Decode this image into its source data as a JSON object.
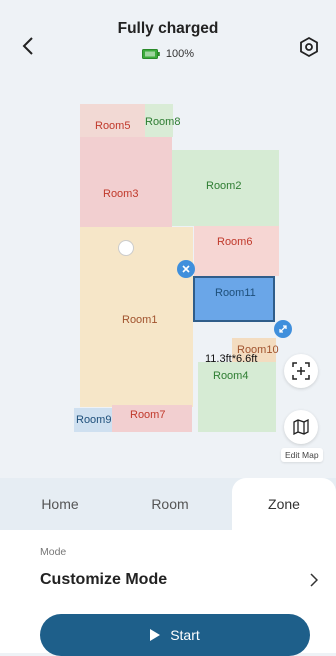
{
  "header": {
    "title": "Fully charged",
    "battery_level": "100%",
    "back_icon": "chevron-left-icon",
    "settings_icon": "settings-icon"
  },
  "map": {
    "rooms": [
      {
        "name": "Room5",
        "color": "#c0392b"
      },
      {
        "name": "Room8",
        "color": "#2e7d32"
      },
      {
        "name": "Room3",
        "color": "#c0392b"
      },
      {
        "name": "Room2",
        "color": "#2e7d32"
      },
      {
        "name": "Room6",
        "color": "#c0392b"
      },
      {
        "name": "Room11",
        "color": "#1e4f7a"
      },
      {
        "name": "Room1",
        "color": "#a0522d"
      },
      {
        "name": "Room10",
        "color": "#a0522d"
      },
      {
        "name": "Room4",
        "color": "#2e7d32"
      },
      {
        "name": "Room9",
        "color": "#1e4f7a"
      },
      {
        "name": "Room7",
        "color": "#c0392b"
      }
    ],
    "zone_size": "11.3ft*6.6ft",
    "edit_map_label": "Edit Map"
  },
  "tabs": [
    {
      "label": "Home",
      "active": false
    },
    {
      "label": "Room",
      "active": false
    },
    {
      "label": "Zone",
      "active": true
    }
  ],
  "mode": {
    "label": "Mode",
    "value": "Customize Mode"
  },
  "start_button": {
    "label": "Start"
  },
  "colors": {
    "accent": "#1e5f8a",
    "zone_fill": "#6aa6e8",
    "marker": "#3f8fdc"
  }
}
